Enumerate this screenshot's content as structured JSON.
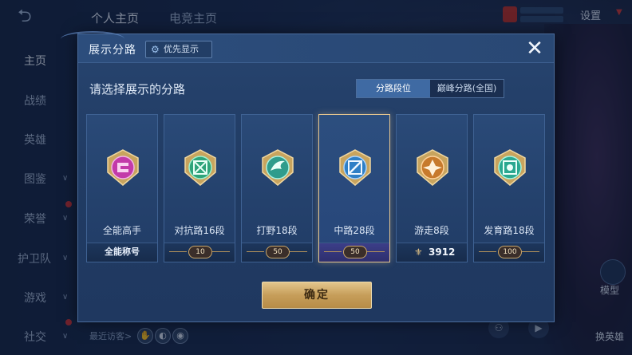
{
  "background": {
    "top_tabs": [
      "个人主页",
      "电竞主页"
    ],
    "settings_label": "设置",
    "side_nav": [
      {
        "label": "主页",
        "active": true
      },
      {
        "label": "战绩"
      },
      {
        "label": "英雄"
      },
      {
        "label": "图鉴"
      },
      {
        "label": "荣誉"
      },
      {
        "label": "护卫队"
      },
      {
        "label": "游戏"
      },
      {
        "label": "社交"
      }
    ],
    "visitors_label": "最近访客>",
    "model_label": "模型",
    "change_hero_label": "换英雄"
  },
  "modal": {
    "title": "展示分路",
    "priority_label": "优先显示",
    "close_icon": "close-icon",
    "subtitle": "请选择展示的分路",
    "toggle": [
      "分路段位",
      "巅峰分路(全国)"
    ],
    "toggle_active": 0,
    "cards": [
      {
        "label": "全能高手",
        "footer_text": "全能称号",
        "footer_type": "text",
        "emblem_color": "#c33aa9",
        "emblem_symbol": "全"
      },
      {
        "label": "对抗路16段",
        "badge": "10",
        "footer_type": "badge",
        "emblem_color": "#2fa47a",
        "emblem_symbol": "⊠"
      },
      {
        "label": "打野18段",
        "badge": "50",
        "footer_type": "badge",
        "emblem_color": "#2f9c8c",
        "emblem_symbol": "❦"
      },
      {
        "label": "中路28段",
        "badge": "50",
        "footer_type": "badge",
        "emblem_color": "#2e7fc6",
        "emblem_symbol": "⧄",
        "selected": true
      },
      {
        "label": "游走8段",
        "peak_value": "3912",
        "footer_type": "peak",
        "emblem_color": "#c77a2c",
        "emblem_symbol": "✪"
      },
      {
        "label": "发育路18段",
        "badge": "100",
        "footer_type": "badge",
        "emblem_color": "#2aa890",
        "emblem_symbol": "◈"
      }
    ],
    "confirm_label": "确定"
  }
}
